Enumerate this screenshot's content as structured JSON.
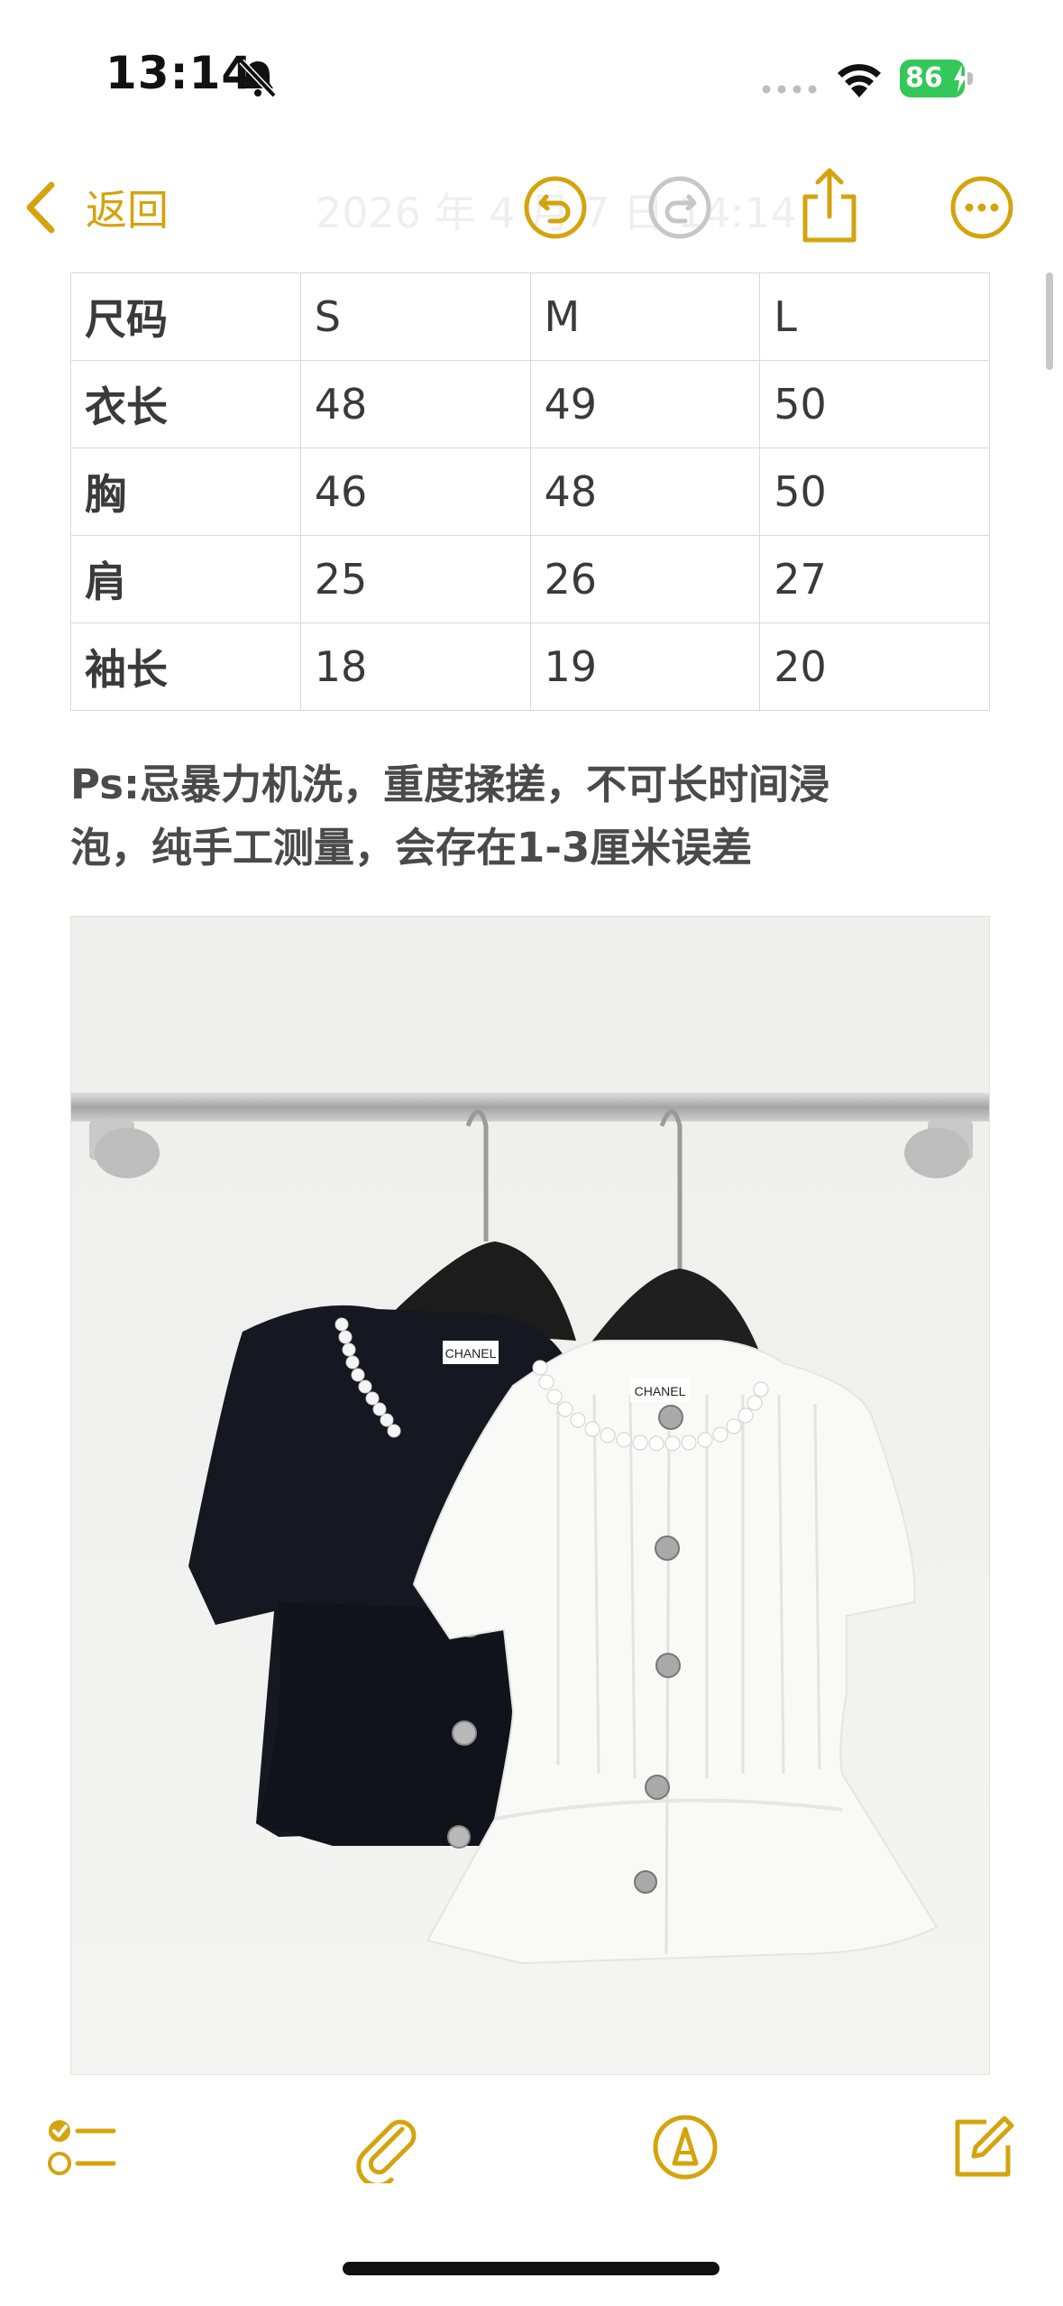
{
  "status_bar": {
    "time": "13:14",
    "battery_percent": "86",
    "icons": [
      "bell-slash-icon",
      "cellular-dots-icon",
      "wifi-icon",
      "battery-charging-icon"
    ]
  },
  "nav": {
    "back_label": "返回",
    "title": "2026 年 4 月 7 日 14:14",
    "icons": [
      "undo-icon",
      "redo-icon",
      "share-icon",
      "more-icon"
    ]
  },
  "size_table": {
    "header": [
      "尺码",
      "S",
      "M",
      "L"
    ],
    "rows": [
      [
        "衣长",
        "48",
        "49",
        "50"
      ],
      [
        "胸",
        "46",
        "48",
        "50"
      ],
      [
        "肩",
        "25",
        "26",
        "27"
      ],
      [
        "袖长",
        "18",
        "19",
        "20"
      ]
    ]
  },
  "note": {
    "line1": "Ps:忌暴力机洗，重度揉搓，不可长时间浸",
    "line2": "泡，纯手工测量，会存在1-3厘米误差"
  },
  "photo": {
    "labels": [
      "CHANEL",
      "CHANEL"
    ]
  },
  "toolbar": {
    "icons": [
      "checklist-icon",
      "paperclip-icon",
      "markup-icon",
      "compose-icon"
    ]
  },
  "colors": {
    "accent": "#d4a40e",
    "battery": "#34c759"
  }
}
